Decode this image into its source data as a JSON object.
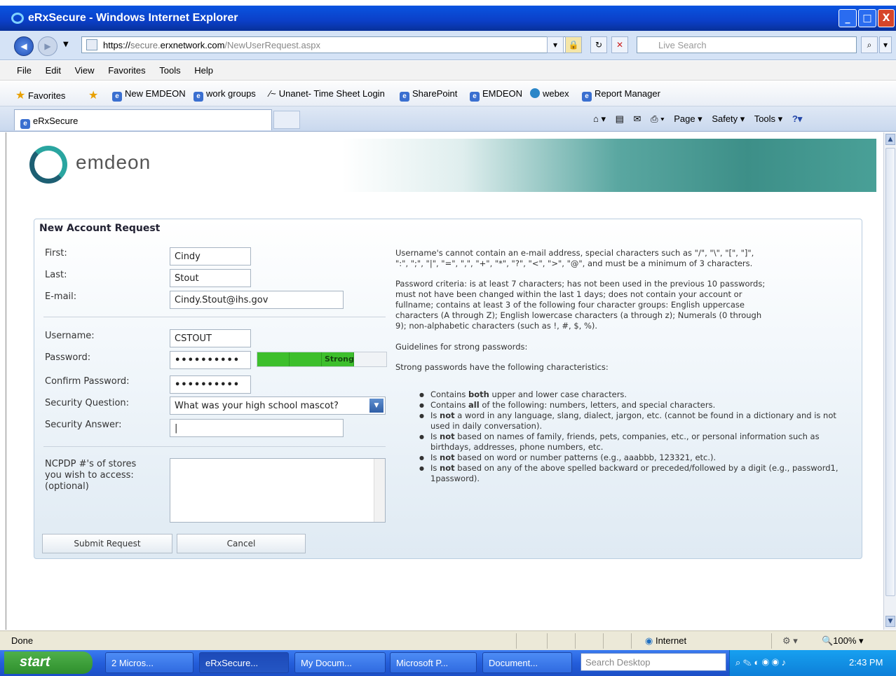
{
  "window": {
    "title": "eRxSecure - Windows Internet Explorer",
    "buttons": [
      "_",
      "□",
      "X"
    ]
  },
  "addressbar": {
    "url_prefix": "https://",
    "url_host_pre": "secure.",
    "url_host": "erxnetwork.com",
    "url_path": "/NewUserRequest.aspx",
    "search_placeholder": "Live Search"
  },
  "menu": [
    "File",
    "Edit",
    "View",
    "Favorites",
    "Tools",
    "Help"
  ],
  "favorites": {
    "label": "Favorites",
    "items": [
      "New EMDEON",
      "work groups",
      "Unanet- Time Sheet Login",
      "SharePoint",
      "EMDEON",
      "webex",
      "Report Manager"
    ]
  },
  "tab": {
    "label": "eRxSecure"
  },
  "commandbar": {
    "page": "Page ▾",
    "safety": "Safety ▾",
    "tools": "Tools ▾"
  },
  "brand": {
    "name": "emdeon"
  },
  "form": {
    "title": "New Account Request",
    "first_label": "First:",
    "first_value": "Cindy",
    "last_label": "Last:",
    "last_value": "Stout",
    "email_label": "E-mail:",
    "email_value": "Cindy.Stout@ihs.gov",
    "username_label": "Username:",
    "username_value": "CSTOUT",
    "password_label": "Password:",
    "password_value": "••••••••••",
    "strength_label": "Strong",
    "strength_level": 0.75,
    "confirm_label": "Confirm Password:",
    "confirm_value": "••••••••••",
    "secq_label": "Security Question:",
    "secq_value": "What was your high school mascot?",
    "seca_label": "Security Answer:",
    "seca_value": "|",
    "ncpdp_label_1": "NCPDP #'s of stores",
    "ncpdp_label_2": "you wish to access:",
    "ncpdp_label_3": "(optional)",
    "submit": "Submit Request",
    "cancel": "Cancel"
  },
  "help": {
    "username_rules_1": "Username's cannot contain an e-mail address, special characters such as \"/\", \"\\\", \"[\", \"]\",",
    "username_rules_2": "\":\", \";\", \"|\", \"=\", \",\", \"+\", \"*\", \"?\", \"<\", \">\", \"@\", and must be a minimum of 3 characters.",
    "password_criteria_1": "Password criteria: is at least 7 characters; has not been used in the previous 10 passwords;",
    "password_criteria_2": "must not have been changed within the last 1 days; does not contain your account or",
    "password_criteria_3": "fullname; contains at least 3 of the following four character groups: English uppercase",
    "password_criteria_4": "characters (A through Z); English lowercase characters (a through z); Numerals (0 through",
    "password_criteria_5": "9); non-alphabetic characters (such as !, #, $, %).",
    "guidelines": "Guidelines for strong passwords:",
    "strong_intro": "Strong passwords have the following characteristics:",
    "bullets": [
      {
        "pre": "Contains ",
        "bold": "both",
        "post": " upper and lower case characters."
      },
      {
        "pre": "Contains ",
        "bold": "all",
        "post": " of the following: numbers, letters, and special characters."
      },
      {
        "pre": "Is ",
        "bold": "not",
        "post": " a word in any language, slang, dialect, jargon, etc. (cannot be found in a dictionary and is not used in daily conversation)."
      },
      {
        "pre": "Is ",
        "bold": "not",
        "post": " based on names of family, friends, pets, companies, etc., or personal information such as birthdays, addresses, phone numbers, etc."
      },
      {
        "pre": "Is ",
        "bold": "not",
        "post": " based on word or number patterns (e.g., aaabbb, 123321, etc.)."
      },
      {
        "pre": "Is ",
        "bold": "not",
        "post": " based on any of the above spelled backward or preceded/followed by a digit (e.g., password1, 1password)."
      }
    ]
  },
  "statusbar": {
    "left": "Done",
    "zone": "Internet",
    "zoom": "100%"
  },
  "taskbar": {
    "start": "start",
    "tasks": [
      "2 Micros...",
      "eRxSecure...",
      "My Docum...",
      "Microsoft P...",
      "Document..."
    ],
    "search": "Search Desktop",
    "clock": "2:43 PM"
  }
}
